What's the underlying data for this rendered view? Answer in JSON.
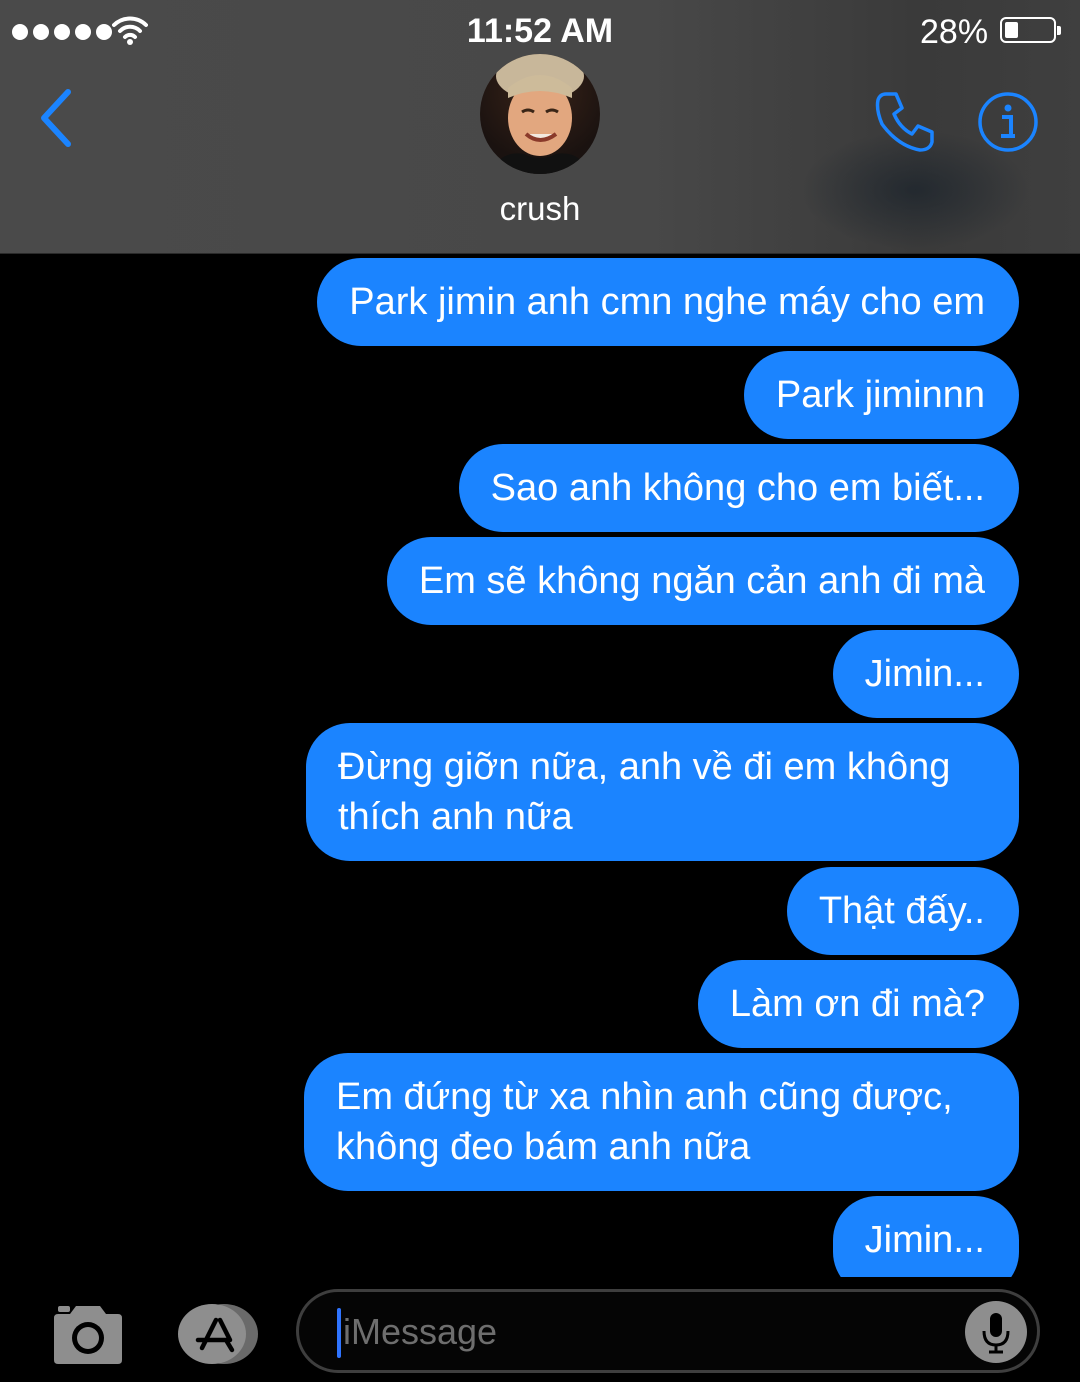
{
  "status_bar": {
    "time": "11:52 AM",
    "battery_percent": "28%",
    "battery_level": 0.28,
    "signal_bars": 5,
    "icons": [
      "signal-dots-icon",
      "wifi-icon",
      "battery-icon"
    ]
  },
  "header": {
    "contact_name": "crush",
    "icons": [
      "back-chevron-icon",
      "phone-icon",
      "info-icon"
    ],
    "accent_color": "#1b84ff"
  },
  "messages": [
    {
      "sender": "me",
      "text": "Park jimin anh cmn nghe máy cho em"
    },
    {
      "sender": "me",
      "text": "Park jiminnn"
    },
    {
      "sender": "me",
      "text": "Sao anh không cho em biết..."
    },
    {
      "sender": "me",
      "text": "Em sẽ không ngăn cản anh đi mà"
    },
    {
      "sender": "me",
      "text": "Jimin..."
    },
    {
      "sender": "me",
      "text": "Đừng giỡn nữa, anh về đi em không thích anh nữa"
    },
    {
      "sender": "me",
      "text": "Thật đấy.."
    },
    {
      "sender": "me",
      "text": "Làm ơn đi mà?"
    },
    {
      "sender": "me",
      "text": "Em đứng từ xa nhìn anh cũng được, không đeo bám anh nữa"
    },
    {
      "sender": "me",
      "text": "Jimin..."
    }
  ],
  "input_bar": {
    "placeholder": "iMessage",
    "icons": [
      "camera-icon",
      "app-store-icon",
      "microphone-icon"
    ]
  },
  "colors": {
    "bubble": "#1b84ff",
    "background": "#000000",
    "header": "#484848"
  }
}
